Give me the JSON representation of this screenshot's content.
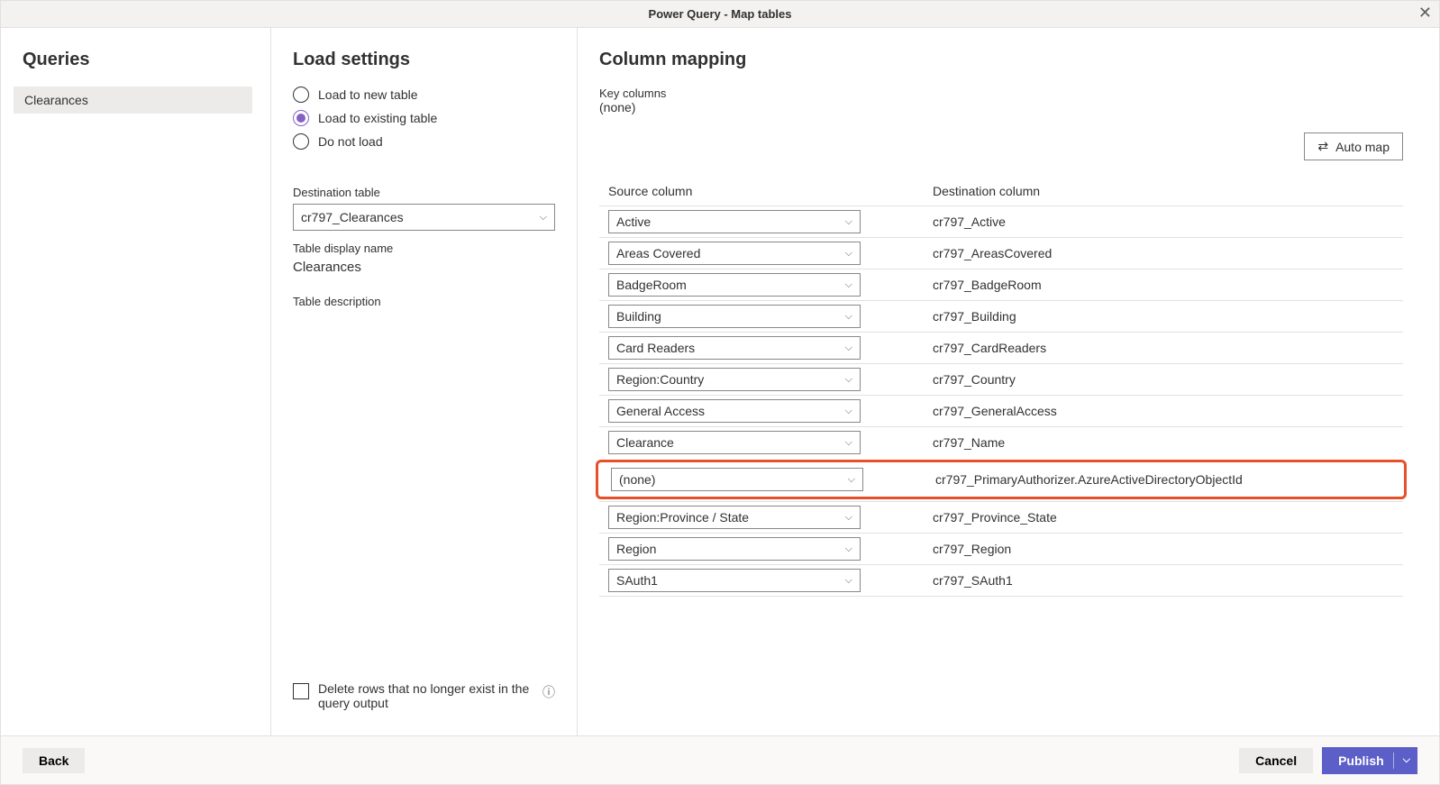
{
  "titleBar": {
    "title": "Power Query - Map tables"
  },
  "queries": {
    "title": "Queries",
    "items": [
      "Clearances"
    ]
  },
  "loadSettings": {
    "title": "Load settings",
    "radios": {
      "new": "Load to new table",
      "existing": "Load to existing table",
      "none": "Do not load",
      "selected": "existing"
    },
    "destinationTableLabel": "Destination table",
    "destinationTableValue": "cr797_Clearances",
    "tableDisplayNameLabel": "Table display name",
    "tableDisplayNameValue": "Clearances",
    "tableDescriptionLabel": "Table description",
    "deleteRowsLabel": "Delete rows that no longer exist in the query output"
  },
  "columnMapping": {
    "title": "Column mapping",
    "keyColumnsLabel": "Key columns",
    "keyColumnsValue": "(none)",
    "autoMapLabel": "Auto map",
    "sourceHeader": "Source column",
    "destHeader": "Destination column",
    "rows": [
      {
        "source": "Active",
        "dest": "cr797_Active",
        "highlight": false
      },
      {
        "source": "Areas Covered",
        "dest": "cr797_AreasCovered",
        "highlight": false
      },
      {
        "source": "BadgeRoom",
        "dest": "cr797_BadgeRoom",
        "highlight": false
      },
      {
        "source": "Building",
        "dest": "cr797_Building",
        "highlight": false
      },
      {
        "source": "Card Readers",
        "dest": "cr797_CardReaders",
        "highlight": false
      },
      {
        "source": "Region:Country",
        "dest": "cr797_Country",
        "highlight": false
      },
      {
        "source": "General Access",
        "dest": "cr797_GeneralAccess",
        "highlight": false
      },
      {
        "source": "Clearance",
        "dest": "cr797_Name",
        "highlight": false
      },
      {
        "source": "(none)",
        "dest": "cr797_PrimaryAuthorizer.AzureActiveDirectoryObjectId",
        "highlight": true
      },
      {
        "source": "Region:Province / State",
        "dest": "cr797_Province_State",
        "highlight": false
      },
      {
        "source": "Region",
        "dest": "cr797_Region",
        "highlight": false
      },
      {
        "source": "SAuth1",
        "dest": "cr797_SAuth1",
        "highlight": false
      }
    ]
  },
  "footer": {
    "back": "Back",
    "cancel": "Cancel",
    "publish": "Publish"
  }
}
